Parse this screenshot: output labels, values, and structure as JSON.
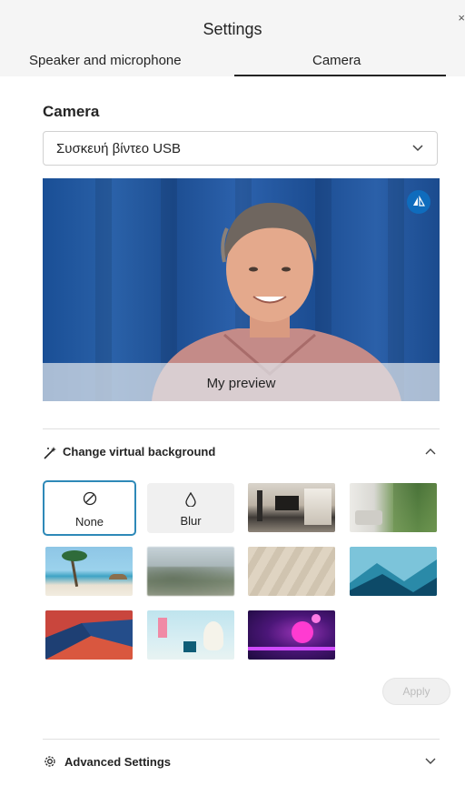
{
  "window": {
    "title": "Settings",
    "close_glyph": "×"
  },
  "tabs": [
    {
      "label": "Speaker and microphone",
      "selected": false
    },
    {
      "label": "Camera",
      "selected": true
    }
  ],
  "camera": {
    "section_label": "Camera",
    "device": {
      "selected": "Συσκευή βίντεο USB",
      "icon": "chevron-down-icon"
    },
    "preview": {
      "label": "My preview",
      "mirror_icon": "mirror-icon"
    }
  },
  "virtual_background": {
    "label": "Change virtual background",
    "icon": "magic-wand-icon",
    "expanded": true,
    "options": [
      {
        "label": "None",
        "icon": "block-icon",
        "selected": true
      },
      {
        "label": "Blur",
        "icon": "droplet-icon",
        "selected": false
      }
    ],
    "images": [
      "office-background",
      "living-room-background",
      "beach-background",
      "blurred-mountains-background",
      "blurred-window-background",
      "blue-hills-background",
      "red-geometric-background",
      "pastel-room-background",
      "purple-neon-background"
    ],
    "apply_label": "Apply",
    "accent": "#2e89b8"
  },
  "advanced": {
    "label": "Advanced Settings",
    "icon": "gear-icon"
  }
}
